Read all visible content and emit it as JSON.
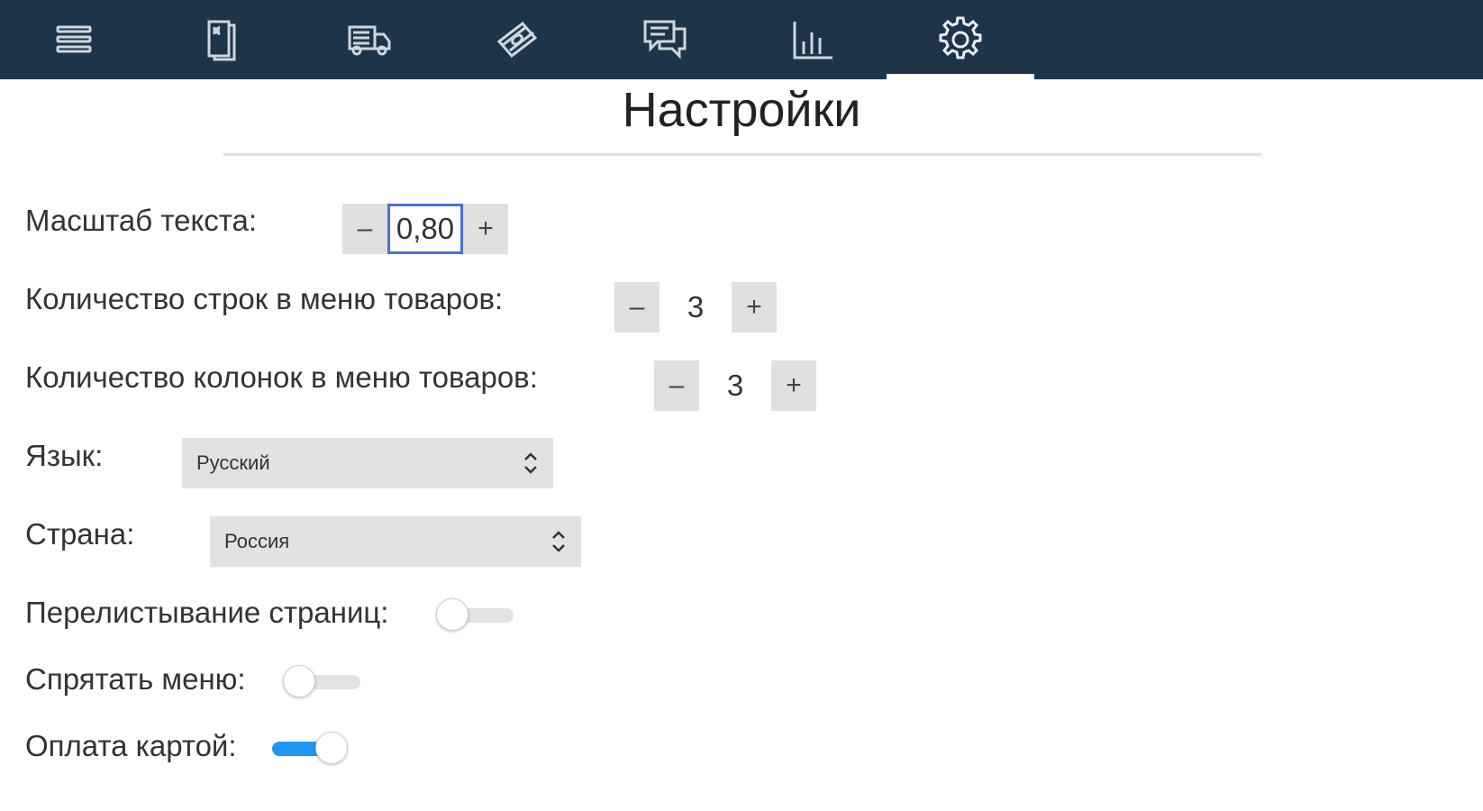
{
  "nav": {
    "tabs": [
      {
        "icon": "menu-icon"
      },
      {
        "icon": "receipt-icon"
      },
      {
        "icon": "delivery-truck-icon"
      },
      {
        "icon": "cash-icon"
      },
      {
        "icon": "chat-icon"
      },
      {
        "icon": "bar-chart-icon"
      },
      {
        "icon": "gear-icon",
        "active": true
      }
    ],
    "background_color": "#1e3448"
  },
  "page": {
    "title": "Настройки"
  },
  "settings": {
    "text_scale": {
      "label": "Масштаб текста:",
      "value": "0,80",
      "minus": "–",
      "plus": "+"
    },
    "rows": {
      "label": "Количество строк в меню товаров:",
      "value": "3",
      "minus": "–",
      "plus": "+"
    },
    "columns": {
      "label": "Количество колонок в меню товаров:",
      "value": "3",
      "minus": "–",
      "plus": "+"
    },
    "language": {
      "label": "Язык:",
      "selected": "Русский"
    },
    "country": {
      "label": "Страна:",
      "selected": "Россия"
    },
    "page_flip": {
      "label": "Перелистывание страниц:",
      "on": false
    },
    "hide_menu": {
      "label": "Спрятать меню:",
      "on": false
    },
    "card_payment": {
      "label": "Оплата картой:",
      "on": true
    }
  },
  "colors": {
    "accent": "#2196f3",
    "focus_border": "#4a6ee0"
  }
}
